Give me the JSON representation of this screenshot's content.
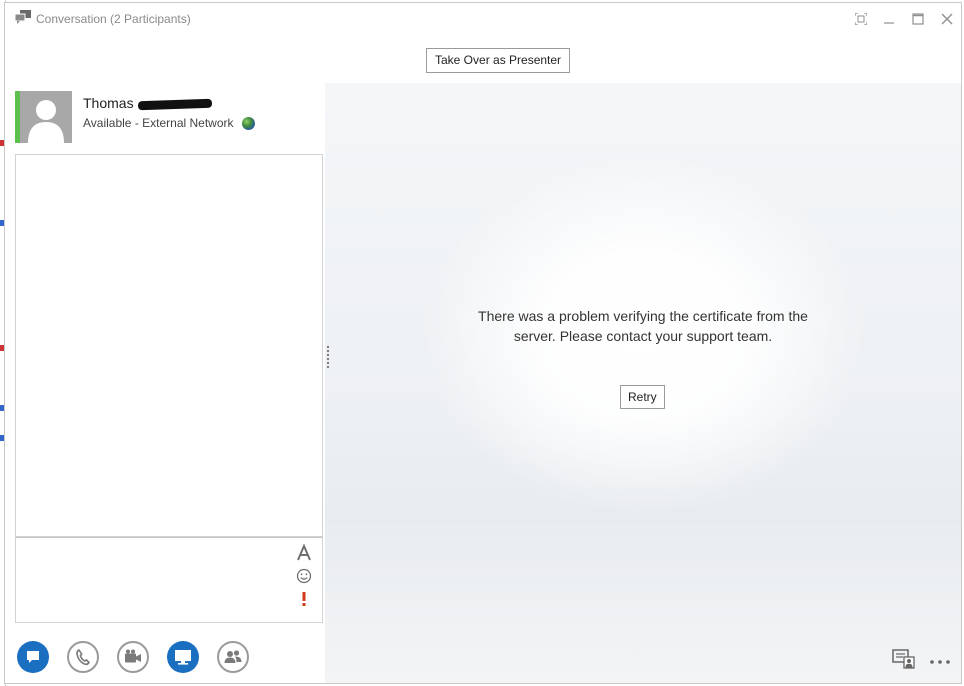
{
  "window": {
    "title": "Conversation (2 Participants)",
    "controls": [
      "restore-layout",
      "minimize",
      "maximize",
      "close"
    ]
  },
  "toolbar": {
    "take_over_label": "Take Over as Presenter"
  },
  "contact": {
    "first_name": "Thomas",
    "status": "Available - External Network",
    "presence_color": "#5cc04d"
  },
  "stage": {
    "message": "There was a problem verifying the certificate from the server. Please contact your support team.",
    "retry_label": "Retry"
  },
  "compose_tools": [
    "font-icon",
    "emoticon-icon",
    "importance-icon"
  ],
  "modalities": [
    {
      "name": "im-button",
      "icon": "chat-bubble-icon",
      "active": true
    },
    {
      "name": "call-button",
      "icon": "phone-icon",
      "active": false
    },
    {
      "name": "video-button",
      "icon": "video-camera-icon",
      "active": false
    },
    {
      "name": "present-button",
      "icon": "monitor-icon",
      "active": true
    },
    {
      "name": "participants-button",
      "icon": "people-icon",
      "active": false
    }
  ],
  "colors": {
    "accent": "#1a6fc0",
    "presence_available": "#5cc04d",
    "importance": "#d23a1e"
  }
}
